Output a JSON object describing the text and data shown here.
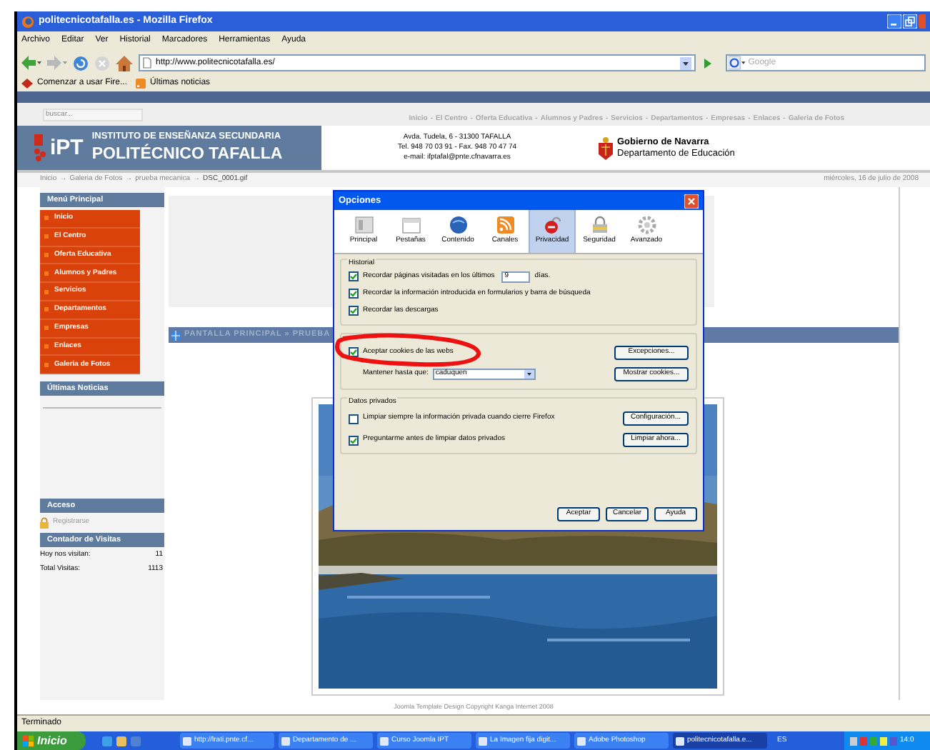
{
  "window": {
    "title": "politecnicotafalla.es - Mozilla Firefox"
  },
  "menu": [
    "Archivo",
    "Editar",
    "Ver",
    "Historial",
    "Marcadores",
    "Herramientas",
    "Ayuda"
  ],
  "address": {
    "url": "http://www.politecnicotafalla.es/"
  },
  "search": {
    "placeholder": "Google"
  },
  "bookmarks": [
    "Comenzar a usar Fire...",
    "Últimas noticias"
  ],
  "site": {
    "search_placeholder": "buscar...",
    "nav_separator": "-",
    "nav": [
      "Inicio",
      "El Centro",
      "Oferta Educativa",
      "Alumnos y Padres",
      "Servicios",
      "Departamentos",
      "Empresas",
      "Enlaces",
      "Galeria de Fotos"
    ],
    "logo": "iPT",
    "school_type": "INSTITUTO DE ENSEÑANZA SECUNDARIA",
    "school_name": "POLITÉCNICO TAFALLA",
    "contact": [
      "Avda. Tudela, 6 - 31300 TAFALLA",
      "Tel. 948 70 03 91 - Fax. 948 70 47 74",
      "e-mail: ifptafal@pnte.cfnavarra.es"
    ],
    "gov": [
      "Gobierno de Navarra",
      "Departamento de Educación"
    ],
    "breadcrumb_separator": "→",
    "breadcrumb": [
      "Inicio",
      "Galeria de Fotos",
      "prueba mecanica",
      "DSC_0001.gif"
    ],
    "date": "miércoles, 16 de julio de 2008"
  },
  "sidebar": {
    "menu_title": "Menú Principal",
    "menu_items": [
      "Inicio",
      "El Centro",
      "Oferta Educativa",
      "Alumnos y Padres",
      "Servicios",
      "Departamentos",
      "Empresas",
      "Enlaces",
      "Galeria de Fotos"
    ],
    "news_title": "Últimas Noticias",
    "access_title": "Acceso",
    "register": "Registrarse",
    "counter_title": "Contador de Visitas",
    "counter": [
      {
        "label": "Hoy nos visitan:",
        "value": "11"
      },
      {
        "label": "Total Visitas:",
        "value": "1113"
      }
    ]
  },
  "content": {
    "path": "PANTALLA PRINCIPAL » PRUEBA",
    "footer": "Joomla Template Design Copyright Kanga Internet 2008"
  },
  "dialog": {
    "title": "Opciones",
    "tabs": [
      {
        "label": "Principal",
        "selected": false
      },
      {
        "label": "Pestañas",
        "selected": false
      },
      {
        "label": "Contenido",
        "selected": false
      },
      {
        "label": "Canales",
        "selected": false
      },
      {
        "label": "Privacidad",
        "selected": true
      },
      {
        "label": "Seguridad",
        "selected": false
      },
      {
        "label": "Avanzado",
        "selected": false
      }
    ],
    "history": {
      "title": "Historial",
      "rows": [
        {
          "label": "Recordar páginas visitadas en los últimos",
          "checked": true,
          "value": "9",
          "suffix": "días."
        },
        {
          "label": "Recordar la información introducida en formularios y barra de búsqueda",
          "checked": true
        },
        {
          "label": "Recordar las descargas",
          "checked": true
        }
      ]
    },
    "cookies": {
      "accept": {
        "label": "Aceptar cookies de las webs",
        "checked": true
      },
      "exceptions_button": "Excepciones...",
      "keep_label": "Mantener hasta que:",
      "keep_value": "caduquen",
      "show_button": "Mostrar cookies..."
    },
    "private": {
      "title": "Datos privados",
      "rows": [
        {
          "label": "Limpiar siempre la información privada cuando cierre Firefox",
          "checked": false,
          "button": "Configuración..."
        },
        {
          "label": "Preguntarme antes de limpiar datos privados",
          "checked": true,
          "button": "Limpiar ahora..."
        }
      ]
    },
    "buttons": [
      "Aceptar",
      "Cancelar",
      "Ayuda"
    ]
  },
  "status_bar": "Terminado",
  "taskbar": {
    "start": "Inicio",
    "items": [
      {
        "label": "http://lrati.pnte.cf...",
        "selected": false
      },
      {
        "label": "Departamento de ...",
        "selected": false
      },
      {
        "label": "Curso Joomla IPT",
        "selected": false
      },
      {
        "label": "La Imagen fija digit...",
        "selected": false
      },
      {
        "label": "Adobe Photoshop",
        "selected": false
      },
      {
        "label": "politecnicotafalla.e...",
        "selected": true
      }
    ],
    "language": "ES",
    "clock": "14:0"
  }
}
